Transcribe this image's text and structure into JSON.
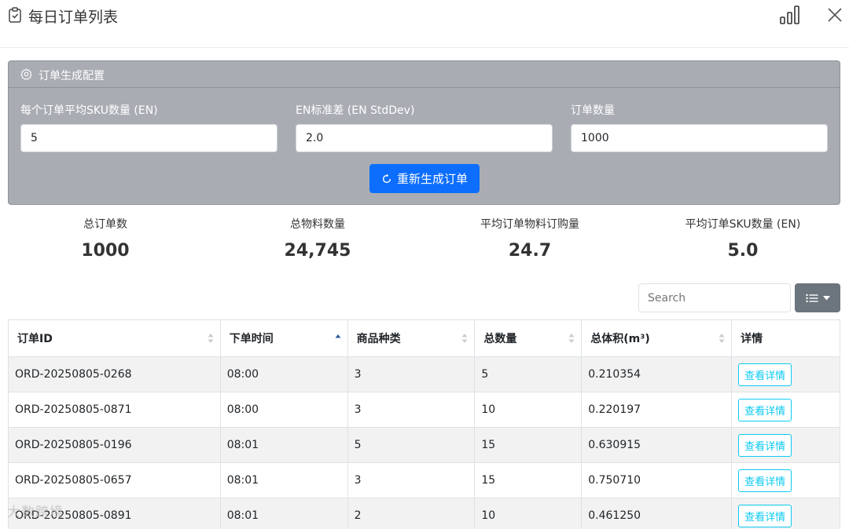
{
  "window": {
    "title": "每日订单列表"
  },
  "config": {
    "header": "订单生成配置",
    "fields": [
      {
        "label": "每个订单平均SKU数量 (EN)",
        "value": "5"
      },
      {
        "label": "EN标准差 (EN StdDev)",
        "value": "2.0"
      },
      {
        "label": "订单数量",
        "value": "1000"
      }
    ],
    "regenerate_label": "重新生成订单"
  },
  "stats": [
    {
      "label": "总订单数",
      "value": "1000"
    },
    {
      "label": "总物料数量",
      "value": "24,745"
    },
    {
      "label": "平均订单物料订购量",
      "value": "24.7"
    },
    {
      "label": "平均订单SKU数量 (EN)",
      "value": "5.0"
    }
  ],
  "search": {
    "placeholder": "Search"
  },
  "table": {
    "headers": [
      "订单ID",
      "下单时间",
      "商品种类",
      "总数量",
      "总体积(m³)",
      "详情"
    ],
    "sorted_column": "下单时间",
    "rows": [
      {
        "id": "ORD-20250805-0268",
        "time": "08:00",
        "kinds": "3",
        "qty": "5",
        "volume": "0.210354",
        "detail": "查看详情"
      },
      {
        "id": "ORD-20250805-0871",
        "time": "08:00",
        "kinds": "3",
        "qty": "10",
        "volume": "0.220197",
        "detail": "查看详情"
      },
      {
        "id": "ORD-20250805-0196",
        "time": "08:01",
        "kinds": "5",
        "qty": "15",
        "volume": "0.630915",
        "detail": "查看详情"
      },
      {
        "id": "ORD-20250805-0657",
        "time": "08:01",
        "kinds": "3",
        "qty": "15",
        "volume": "0.750710",
        "detail": "查看详情"
      },
      {
        "id": "ORD-20250805-0891",
        "time": "08:01",
        "kinds": "2",
        "qty": "10",
        "volume": "0.461250",
        "detail": "查看详情"
      }
    ]
  },
  "watermark": "大数跨境",
  "colors": {
    "accent": "#0d6efd",
    "info": "#0dcaf0",
    "config_bg": "#a9adb3",
    "secondary": "#6c757d"
  }
}
